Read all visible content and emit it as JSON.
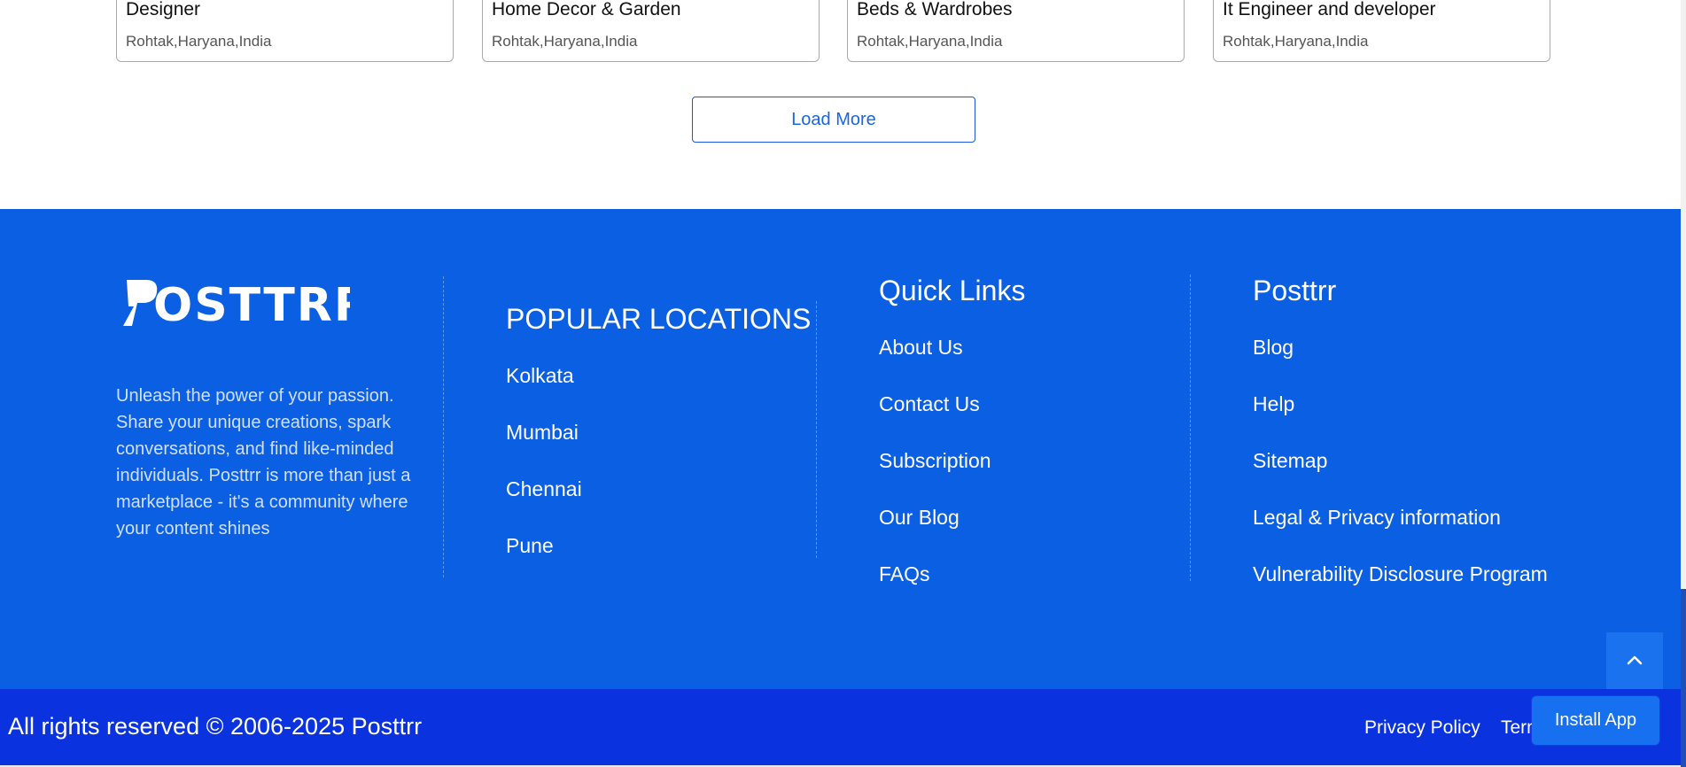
{
  "listings": [
    {
      "title": "Designer",
      "location": "Rohtak,Haryana,India"
    },
    {
      "title": "Home Decor & Garden",
      "location": "Rohtak,Haryana,India"
    },
    {
      "title": "Beds & Wardrobes",
      "location": "Rohtak,Haryana,India"
    },
    {
      "title": "It Engineer and developer",
      "location": "Rohtak,Haryana,India"
    }
  ],
  "load_more_label": "Load More",
  "footer": {
    "brand": "POSTTRR",
    "about": "Unleash the power of your passion. Share your unique creations, spark conversations, and find like-minded individuals. Posttrr is more than just a marketplace - it's a community where your content shines",
    "popular_locations": {
      "heading": "POPULAR LOCATIONS",
      "items": [
        "Kolkata",
        "Mumbai",
        "Chennai",
        "Pune"
      ]
    },
    "quick_links": {
      "heading": "Quick Links",
      "items": [
        "About Us",
        "Contact Us",
        "Subscription",
        "Our Blog",
        "FAQs"
      ]
    },
    "posttrr": {
      "heading": "Posttrr",
      "items": [
        "Blog",
        "Help",
        "Sitemap",
        "Legal & Privacy information",
        "Vulnerability Disclosure Program"
      ]
    }
  },
  "bottom_bar": {
    "copyright": "All rights reserved © 2006-2025 Posttrr",
    "privacy_policy": "Privacy Policy",
    "terms": "Terms"
  },
  "install_app_label": "Install App",
  "icons": {
    "back_to_top": "chevron-up-icon"
  },
  "colors": {
    "footer_bg": "#0a5fe3",
    "bottom_bar_bg": "#0a33df",
    "accent": "#1a66e0"
  }
}
